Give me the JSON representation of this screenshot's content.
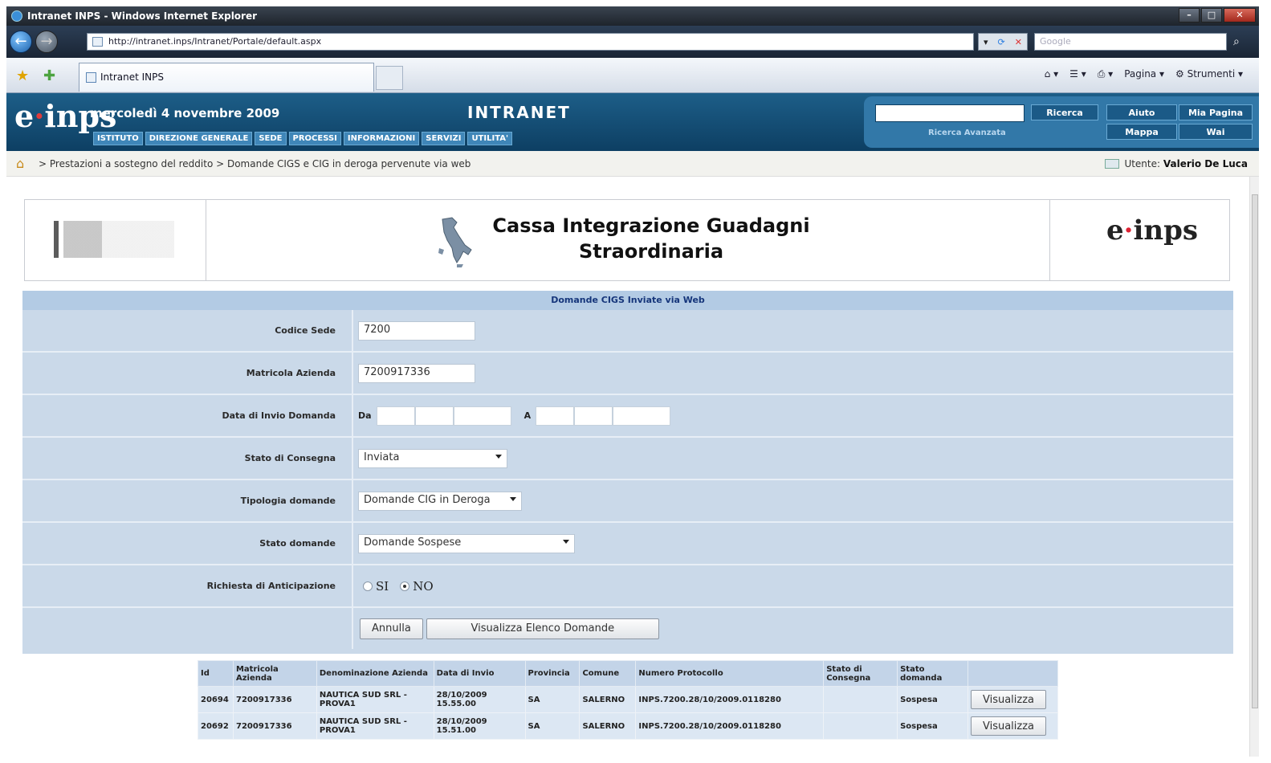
{
  "window": {
    "title": "Intranet INPS - Windows Internet Explorer",
    "url": "http://intranet.inps/Intranet/Portale/default.aspx",
    "search_placeholder": "Google",
    "tab_label": "Intranet INPS",
    "cmd_pagina": "Pagina",
    "cmd_strumenti": "Strumenti"
  },
  "header": {
    "date": "mercoledì 4 novembre 2009",
    "title": "INTRANET",
    "menu": [
      "ISTITUTO",
      "DIREZIONE GENERALE",
      "SEDE",
      "PROCESSI",
      "INFORMAZIONI",
      "SERVIZI",
      "UTILITA'"
    ],
    "search_button": "Ricerca",
    "advanced_search": "Ricerca Avanzata",
    "help": "Aiuto",
    "my_page": "Mia Pagina",
    "map": "Mappa",
    "wai": "Wai"
  },
  "breadcrumb": {
    "path": "> Prestazioni a sostegno del reddito > Domande CIGS e CIG in deroga pervenute via web",
    "user_label": "Utente:",
    "user_name": "Valerio De Luca"
  },
  "banner": {
    "line1": "Cassa Integrazione Guadagni",
    "line2": "Straordinaria"
  },
  "form": {
    "heading": "Domande CIGS Inviate via Web",
    "codice_sede_label": "Codice Sede",
    "codice_sede_value": "7200",
    "matricola_label": "Matricola Azienda",
    "matricola_value": "7200917336",
    "data_invio_label": "Data di Invio Domanda",
    "da_label": "Da",
    "a_label": "A",
    "stato_consegna_label": "Stato di Consegna",
    "stato_consegna_value": "Inviata",
    "tipologia_label": "Tipologia domande",
    "tipologia_value": "Domande CIG in Deroga",
    "stato_domande_label": "Stato domande",
    "stato_domande_value": "Domande Sospese",
    "anticipazione_label": "Richiesta di Anticipazione",
    "si_label": "SI",
    "no_label": "NO",
    "annulla": "Annulla",
    "visualizza_elenco": "Visualizza Elenco Domande"
  },
  "table": {
    "headers": [
      "Id",
      "Matricola Azienda",
      "Denominazione Azienda",
      "Data di Invio",
      "Provincia",
      "Comune",
      "Numero Protocollo",
      "Stato di Consegna",
      "Stato domanda",
      ""
    ],
    "rows": [
      [
        "20694",
        "7200917336",
        "NAUTICA SUD SRL - PROVA1",
        "28/10/2009 15.55.00",
        "SA",
        "SALERNO",
        "INPS.7200.28/10/2009.0118280",
        "",
        "Sospesa",
        "Visualizza"
      ],
      [
        "20692",
        "7200917336",
        "NAUTICA SUD SRL - PROVA1",
        "28/10/2009 15.51.00",
        "SA",
        "SALERNO",
        "INPS.7200.28/10/2009.0118280",
        "",
        "Sospesa",
        "Visualizza"
      ]
    ]
  }
}
